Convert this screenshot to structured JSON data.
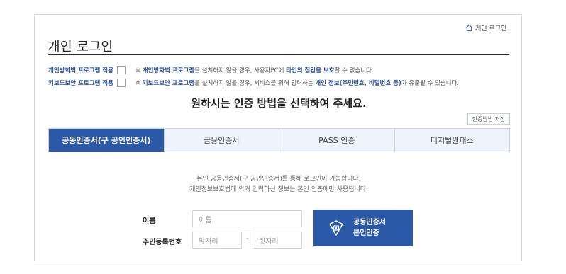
{
  "header": {
    "home_link": "개인 로그인",
    "title": "개인 로그인"
  },
  "options": [
    {
      "label": "개인방화벽 프로그램 적용",
      "note": [
        "※ ",
        "개인방화벽 프로그램",
        "을 설치하지 않을 경우, 사용자PC에 ",
        "타인의 침입을 보호",
        "할 수 없습니다."
      ]
    },
    {
      "label": "키보드보안 프로그램 적용",
      "note": [
        "※ ",
        "키보드보안 프로그램",
        "을 설치하지 않을 경우, 서비스를 위해 입력하는 ",
        "개인 정보(주민번호, 비밀번호 등)",
        "가 유출될 수 있습니다."
      ]
    }
  ],
  "subtitle": "원하시는 인증 방법을 선택하여 주세요.",
  "save_button": "인증방법 저장",
  "tabs": [
    {
      "label": "공동인증서(구 공인인증서)",
      "active": true
    },
    {
      "label": "금융인증서",
      "active": false
    },
    {
      "label": "PASS 인증",
      "active": false
    },
    {
      "label": "디지털원패스",
      "active": false
    }
  ],
  "description": [
    "본인 공동인증서(구 공인인증서)를 통해 로그인이 가능합니다.",
    "개인정보보호법에 의거 입력하신 정보는 본인 인증에만 사용됩니다."
  ],
  "form": {
    "name_label": "이름",
    "name_placeholder": "이름",
    "rrn_label": "주민등록번호",
    "rrn_front_placeholder": "앞자리",
    "rrn_separator": "-",
    "rrn_back_placeholder": "뒷자리"
  },
  "cert_button": {
    "line1": "공동인증서",
    "line2": "본인인증"
  },
  "colors": {
    "accent": "#2b59a8",
    "tab_bg": "#eef4fb",
    "link_blue": "#2a4fa0"
  }
}
